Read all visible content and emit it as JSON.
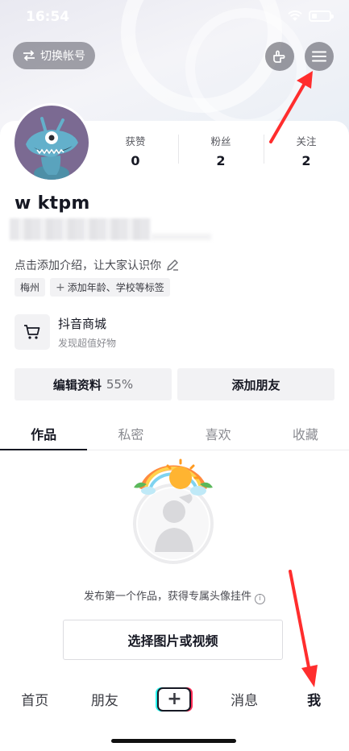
{
  "status_bar": {
    "time": "16:54",
    "wifi_icon": "wifi-icon",
    "battery_icon": "battery-icon"
  },
  "header": {
    "switch_account_label": "切换帐号",
    "switch_icon": "swap-arrows-icon",
    "hand_icon": "hand-pointer-icon",
    "menu_icon": "hamburger-menu-icon"
  },
  "profile": {
    "username": "w ktpm",
    "stats": [
      {
        "label": "获赞",
        "value": "0"
      },
      {
        "label": "粉丝",
        "value": "2"
      },
      {
        "label": "关注",
        "value": "2"
      }
    ],
    "intro_placeholder": "点击添加介绍，让大家认识你",
    "tags": [
      {
        "label": "梅州"
      },
      {
        "label": "添加年龄、学校等标签"
      }
    ]
  },
  "shop": {
    "title": "抖音商城",
    "subtitle": "发现超值好物"
  },
  "actions": {
    "edit_profile_label": "编辑资料",
    "edit_profile_percent": "55%",
    "add_friend_label": "添加朋友"
  },
  "tabs": [
    {
      "label": "作品",
      "active": true
    },
    {
      "label": "私密",
      "active": false
    },
    {
      "label": "喜欢",
      "active": false
    },
    {
      "label": "收藏",
      "active": false
    }
  ],
  "empty_state": {
    "message": "发布第一个作品，获得专属头像挂件",
    "select_button_label": "选择图片或视频"
  },
  "bottom_nav": [
    {
      "label": "首页",
      "active": false
    },
    {
      "label": "朋友",
      "active": false
    },
    {
      "label": "+",
      "active": false
    },
    {
      "label": "消息",
      "active": false
    },
    {
      "label": "我",
      "active": true
    }
  ],
  "colors": {
    "accent_red": "#fe2c55",
    "accent_cyan": "#25f4ee",
    "arrow_red": "#ff2d2d"
  }
}
